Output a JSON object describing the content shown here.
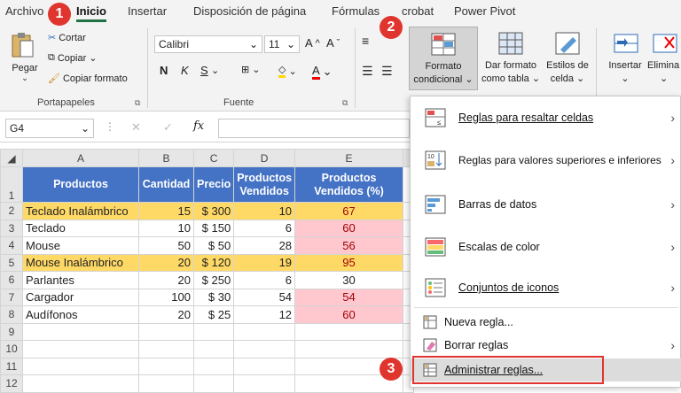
{
  "menubar": {
    "tabs": [
      "Archivo",
      "Inicio",
      "Insertar",
      "Disposición de página",
      "Fórmulas",
      "crobat",
      "Power Pivot"
    ]
  },
  "ribbon": {
    "clipboard": {
      "paste": "Pegar",
      "cut": "Cortar",
      "copy": "Copiar",
      "format_painter": "Copiar formato",
      "group": "Portapapeles"
    },
    "font": {
      "name": "Calibri",
      "size": "11",
      "bold": "N",
      "italic": "K",
      "underline": "S",
      "group": "Fuente"
    },
    "styles": {
      "conditional": [
        "Formato",
        "condicional"
      ],
      "as_table": [
        "Dar formato",
        "como tabla"
      ],
      "cell_styles": [
        "Estilos de",
        "celda"
      ]
    },
    "cells": {
      "insert": "Insertar",
      "delete": "Elimina"
    }
  },
  "formula_bar": {
    "name_box": "G4",
    "fx": "fx"
  },
  "badges": [
    "1",
    "2",
    "3"
  ],
  "columns": [
    "A",
    "B",
    "C",
    "D",
    "E"
  ],
  "header_row": [
    "Productos",
    "Cantidad",
    "Precio",
    "Productos Vendidos",
    "Productos Vendidos (%)"
  ],
  "rows": [
    {
      "n": "2",
      "cells": [
        "Teclado Inalámbrico",
        "15",
        "$ 300",
        "10",
        "67"
      ],
      "hl": true,
      "red": false
    },
    {
      "n": "3",
      "cells": [
        "Teclado",
        "10",
        "$ 150",
        "6",
        "60"
      ],
      "hl": false,
      "red": true
    },
    {
      "n": "4",
      "cells": [
        "Mouse",
        "50",
        "$ 50",
        "28",
        "56"
      ],
      "hl": false,
      "red": true
    },
    {
      "n": "5",
      "cells": [
        "Mouse Inalámbrico",
        "20",
        "$ 120",
        "19",
        "95"
      ],
      "hl": true,
      "red": false
    },
    {
      "n": "6",
      "cells": [
        "Parlantes",
        "20",
        "$ 250",
        "6",
        "30"
      ],
      "hl": false,
      "red": false
    },
    {
      "n": "7",
      "cells": [
        "Cargador",
        "100",
        "$ 30",
        "54",
        "54"
      ],
      "hl": false,
      "red": true
    },
    {
      "n": "8",
      "cells": [
        "Audífonos",
        "20",
        "$ 25",
        "12",
        "60"
      ],
      "hl": false,
      "red": true
    },
    {
      "n": "9",
      "cells": [
        "",
        "",
        "",
        "",
        ""
      ],
      "hl": false,
      "red": false
    },
    {
      "n": "10",
      "cells": [
        "",
        "",
        "",
        "",
        ""
      ],
      "hl": false,
      "red": false
    },
    {
      "n": "11",
      "cells": [
        "",
        "",
        "",
        "",
        ""
      ],
      "hl": false,
      "red": false
    },
    {
      "n": "12",
      "cells": [
        "",
        "",
        "",
        "",
        ""
      ],
      "hl": false,
      "red": false
    }
  ],
  "menu": {
    "items": [
      {
        "label": "Reglas para resaltar celdas",
        "icon": "highlight-rules-icon"
      },
      {
        "label": "Reglas para valores superiores e inferiores",
        "icon": "top-bottom-rules-icon"
      },
      {
        "label": "Barras de datos",
        "icon": "data-bars-icon"
      },
      {
        "label": "Escalas de color",
        "icon": "color-scales-icon"
      },
      {
        "label": "Conjuntos de iconos",
        "icon": "icon-sets-icon"
      }
    ],
    "new_rule": "Nueva regla...",
    "clear_rules": "Borrar reglas",
    "manage_rules": "Administrar reglas..."
  },
  "colors": {
    "header": "#4472c4",
    "highlight": "#ffd966",
    "red_fill": "#ffc7ce",
    "red_text": "#9c0006",
    "badge": "#e0352f"
  }
}
